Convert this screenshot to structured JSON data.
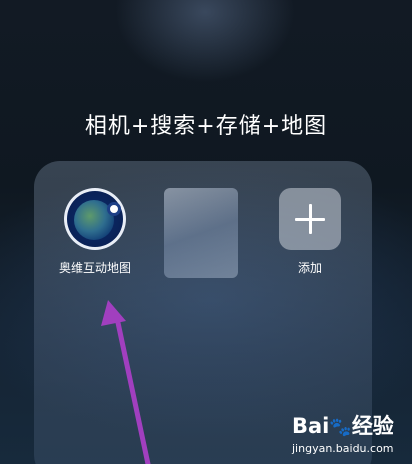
{
  "folder": {
    "title": "相机+搜索+存储+地图"
  },
  "apps": [
    {
      "label": "奥维互动地图",
      "icon": "aowei-map-icon"
    },
    {
      "label": "",
      "icon": "blurred-app-icon"
    },
    {
      "label": "添加",
      "icon": "plus-icon"
    }
  ],
  "annotation": {
    "arrow_color": "#a13fbf"
  },
  "watermark": {
    "logo_text": "Bai",
    "logo_paw": "🐾",
    "logo_suffix": "经验",
    "site": "jingyan.baidu.com"
  }
}
